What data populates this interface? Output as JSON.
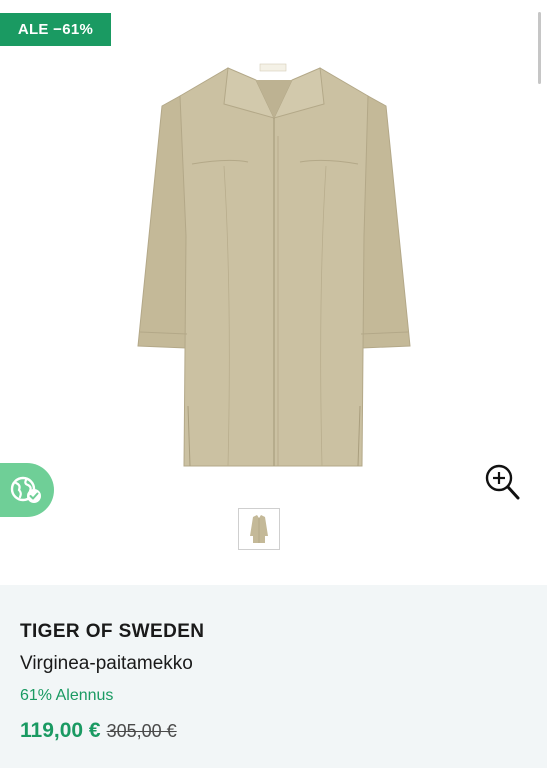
{
  "badge": {
    "sale_label": "ALE −61%"
  },
  "colors": {
    "accent_green": "#1a9a62",
    "sustain_green": "#6fcf97",
    "info_bg": "#f2f6f7",
    "product_beige": "#c9bf9f"
  },
  "icons": {
    "sustain": "globe-check-icon",
    "zoom": "zoom-in-icon"
  },
  "gallery": {
    "thumbnail_count": 1
  },
  "product": {
    "brand": "TIGER OF SWEDEN",
    "name": "Virginea-paitamekko",
    "discount_text": "61% Alennus",
    "price": "119,00 €",
    "old_price": "305,00 €"
  }
}
